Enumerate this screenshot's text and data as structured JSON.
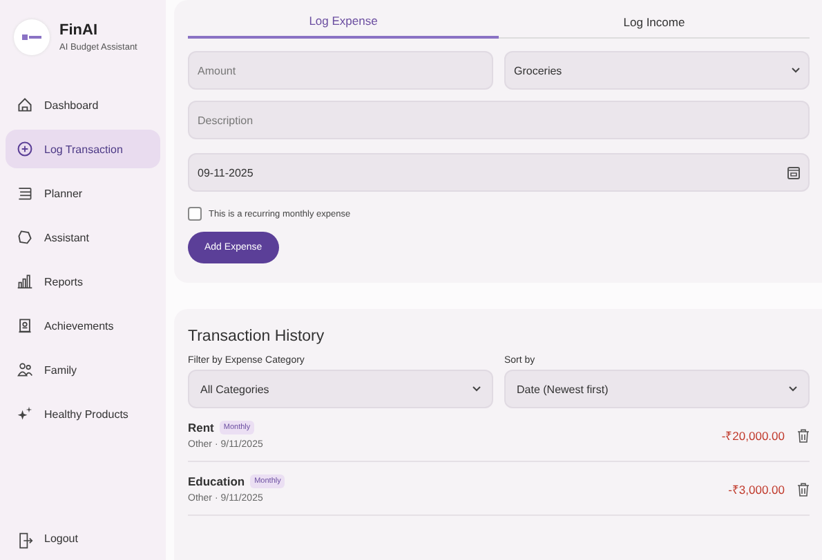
{
  "sidebar": {
    "app_name": "FinAI",
    "tagline": "AI Budget Assistant",
    "items": [
      {
        "label": "Dashboard",
        "selected": false
      },
      {
        "label": "Log Transaction",
        "selected": true
      },
      {
        "label": "Planner",
        "selected": false
      },
      {
        "label": "Assistant",
        "selected": false
      },
      {
        "label": "Reports",
        "selected": false
      },
      {
        "label": "Achievements",
        "selected": false
      },
      {
        "label": "Family",
        "selected": false
      },
      {
        "label": "Healthy Products",
        "selected": false
      }
    ],
    "logout": "Logout"
  },
  "form": {
    "tabs": [
      {
        "label": "Log Expense",
        "selected": true
      },
      {
        "label": "Log Income",
        "selected": false
      }
    ],
    "amount": {
      "placeholder": "Amount"
    },
    "category": {
      "value": "Groceries"
    },
    "description": {
      "placeholder": "Description"
    },
    "date": {
      "value": "09-11-2025"
    },
    "recurring": {
      "label": "This is a recurring monthly expense",
      "checked": false
    },
    "submit": "Add Expense"
  },
  "history": {
    "title": "Transaction History",
    "filter": {
      "label": "Filter by Expense Category",
      "value": "All Categories"
    },
    "sort": {
      "label": "Sort by",
      "value": "Date (Newest first)"
    },
    "rows": [
      {
        "name": "Rent",
        "badge": "Monthly",
        "meta": "Other · 9/11/2025",
        "amount": "-₹20,000.00"
      },
      {
        "name": "Education",
        "badge": "Monthly",
        "meta": "Other · 9/11/2025",
        "amount": "-₹3,000.00"
      }
    ]
  }
}
